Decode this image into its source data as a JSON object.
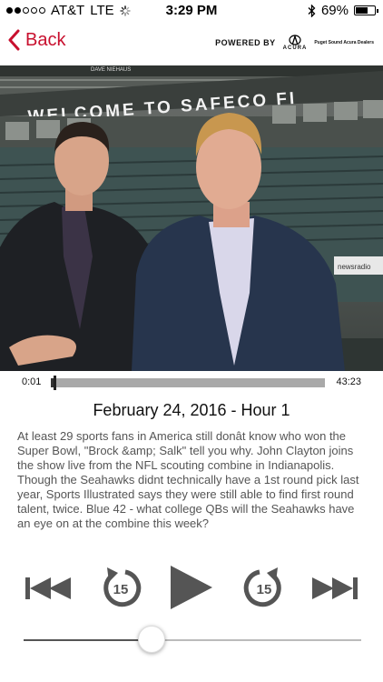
{
  "status_bar": {
    "carrier": "AT&T",
    "network": "LTE",
    "time": "3:29 PM",
    "battery_text": "69%",
    "battery_level": 0.69,
    "signal_bars": 2
  },
  "nav": {
    "back_label": "Back",
    "powered_by": "POWERED BY",
    "sponsor_logo": "ACURA",
    "sponsor_dealer": "Puget Sound Acura Dealers"
  },
  "hero": {
    "stadium_sign": "WELCOME TO SAFECO FI",
    "upper_sign": "DAVE NIEHAUS",
    "side_sign": "newsradio"
  },
  "player": {
    "elapsed": "0:01",
    "total": "43:23",
    "progress": 0.01
  },
  "episode": {
    "title": "February 24, 2016 - Hour 1",
    "description": "At least 29 sports fans in America still donât know who won the Super Bowl, \"Brock &amp; Salk\" tell you why. John Clayton joins the show live from the NFL scouting combine in Indianapolis. Though the Seahawks didnt technically have a 1st round pick last year, Sports Illustrated says they were still able to find first round talent, twice. Blue 42 - what college QBs will the Seahawks have an eye on at the combine this week?"
  },
  "controls": {
    "skip_back_label": "15",
    "skip_forward_label": "15",
    "icon_color": "#555555"
  },
  "volume": {
    "level": 0.38
  },
  "colors": {
    "accent": "#c8102e"
  }
}
